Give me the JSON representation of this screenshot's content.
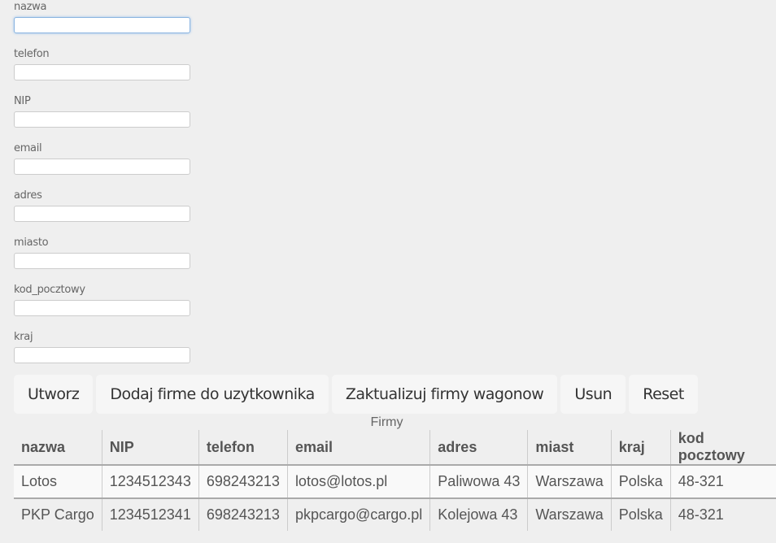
{
  "form": {
    "fields": [
      {
        "label": "nazwa",
        "value": ""
      },
      {
        "label": "telefon",
        "value": ""
      },
      {
        "label": "NIP",
        "value": ""
      },
      {
        "label": "email",
        "value": ""
      },
      {
        "label": "adres",
        "value": ""
      },
      {
        "label": "miasto",
        "value": ""
      },
      {
        "label": "kod_pocztowy",
        "value": ""
      },
      {
        "label": "kraj",
        "value": ""
      }
    ]
  },
  "buttons": [
    "Utworz",
    "Dodaj firme do uzytkownika",
    "Zaktualizuj firmy wagonow",
    "Usun",
    "Reset"
  ],
  "table": {
    "caption": "Firmy",
    "headers": [
      "nazwa",
      "NIP",
      "telefon",
      "email",
      "adres",
      "miast",
      "kraj",
      "kod pocztowy"
    ],
    "rows": [
      [
        "Lotos",
        "1234512343",
        "698243213",
        "lotos@lotos.pl",
        "Paliwowa 43",
        "Warszawa",
        "Polska",
        "48-321"
      ],
      [
        "PKP Cargo",
        "1234512341",
        "698243213",
        "pkpcargo@cargo.pl",
        "Kolejowa 43",
        "Warszawa",
        "Polska",
        "48-321"
      ]
    ]
  }
}
